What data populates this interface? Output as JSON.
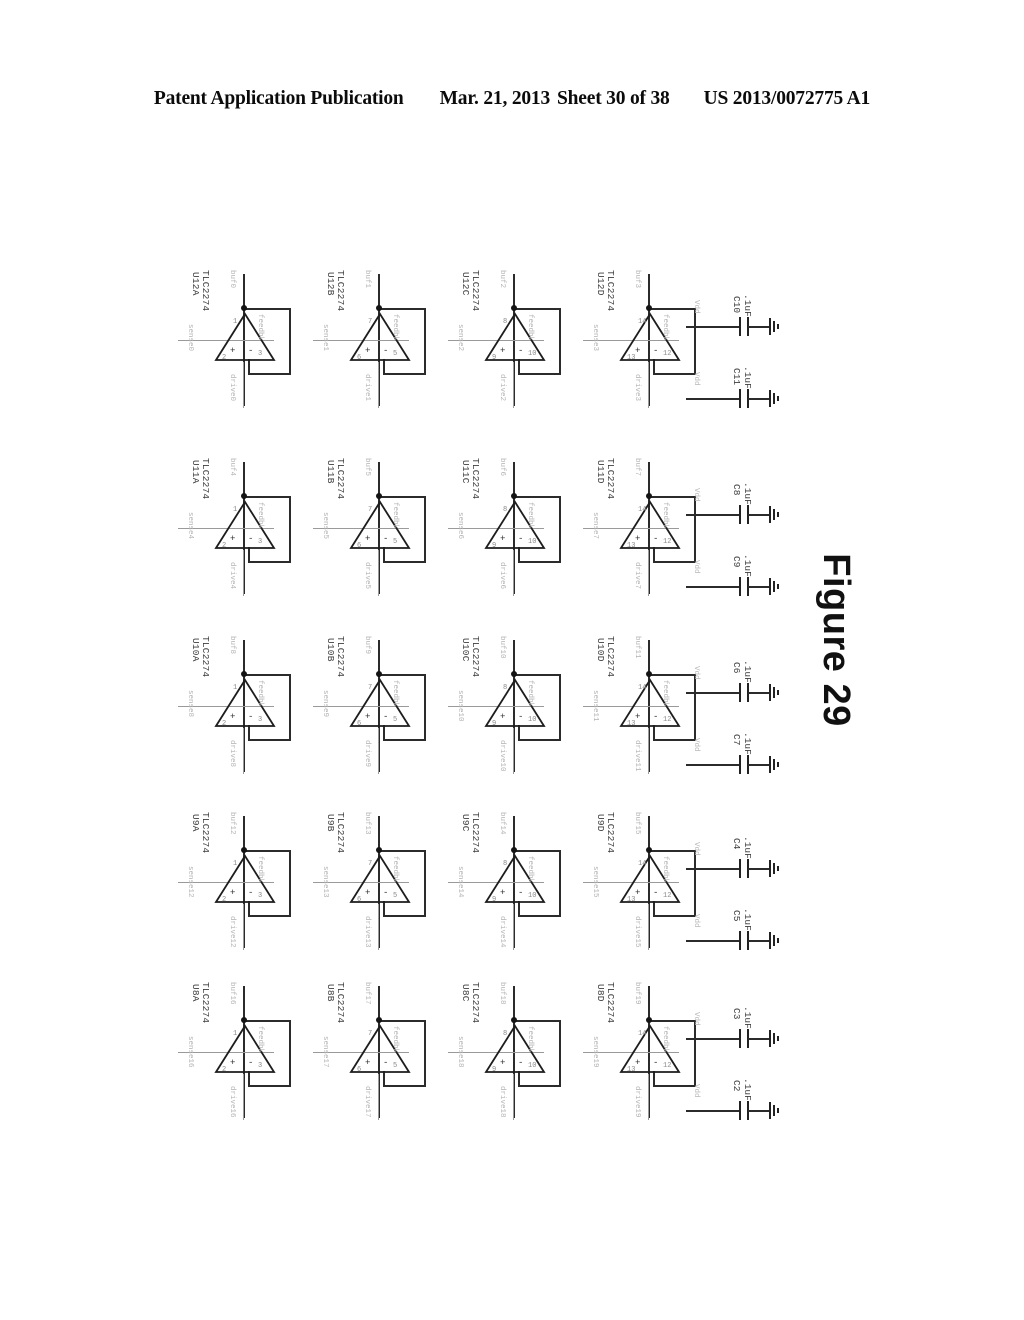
{
  "header": {
    "publication": "Patent Application Publication",
    "date": "Mar. 21, 2013",
    "sheet": "Sheet 30 of 38",
    "docnum": "US 2013/0072775 A1"
  },
  "figure": {
    "caption": "Figure 29"
  },
  "schematic": {
    "part_number": "TLC2274",
    "pin_labels": {
      "plus": "+",
      "minus": "-"
    },
    "opamps": [
      {
        "refdes": "U12A",
        "part": "TLC2274",
        "in_net": "sense0",
        "out_net": "buf0",
        "fb_net": "feedbk",
        "sup_net": "drive0",
        "pin_out": "1",
        "pin_minus": "2",
        "pin_plus": "3"
      },
      {
        "refdes": "U12B",
        "part": "TLC2274",
        "in_net": "sense1",
        "out_net": "buf1",
        "fb_net": "feedbk",
        "sup_net": "drive1",
        "pin_out": "7",
        "pin_minus": "6",
        "pin_plus": "5"
      },
      {
        "refdes": "U12C",
        "part": "TLC2274",
        "in_net": "sense2",
        "out_net": "buf2",
        "fb_net": "feedbk",
        "sup_net": "drive2",
        "pin_out": "8",
        "pin_minus": "9",
        "pin_plus": "10"
      },
      {
        "refdes": "U12D",
        "part": "TLC2274",
        "in_net": "sense3",
        "out_net": "buf3",
        "fb_net": "feedbk",
        "sup_net": "drive3",
        "pin_out": "14",
        "pin_minus": "13",
        "pin_plus": "12"
      },
      {
        "refdes": "U11A",
        "part": "TLC2274",
        "in_net": "sense4",
        "out_net": "buf4",
        "fb_net": "feedbk",
        "sup_net": "drive4",
        "pin_out": "1",
        "pin_minus": "2",
        "pin_plus": "3"
      },
      {
        "refdes": "U11B",
        "part": "TLC2274",
        "in_net": "sense5",
        "out_net": "buf5",
        "fb_net": "feedbk",
        "sup_net": "drive5",
        "pin_out": "7",
        "pin_minus": "6",
        "pin_plus": "5"
      },
      {
        "refdes": "U11C",
        "part": "TLC2274",
        "in_net": "sense6",
        "out_net": "buf6",
        "fb_net": "feedbk",
        "sup_net": "drive6",
        "pin_out": "8",
        "pin_minus": "9",
        "pin_plus": "10"
      },
      {
        "refdes": "U11D",
        "part": "TLC2274",
        "in_net": "sense7",
        "out_net": "buf7",
        "fb_net": "feedbk",
        "sup_net": "drive7",
        "pin_out": "14",
        "pin_minus": "13",
        "pin_plus": "12"
      },
      {
        "refdes": "U10A",
        "part": "TLC2274",
        "in_net": "sense8",
        "out_net": "buf8",
        "fb_net": "feedbk",
        "sup_net": "drive8",
        "pin_out": "1",
        "pin_minus": "2",
        "pin_plus": "3"
      },
      {
        "refdes": "U10B",
        "part": "TLC2274",
        "in_net": "sense9",
        "out_net": "buf9",
        "fb_net": "feedbk",
        "sup_net": "drive9",
        "pin_out": "7",
        "pin_minus": "6",
        "pin_plus": "5"
      },
      {
        "refdes": "U10C",
        "part": "TLC2274",
        "in_net": "sense10",
        "out_net": "buf10",
        "fb_net": "feedbk",
        "sup_net": "drive10",
        "pin_out": "8",
        "pin_minus": "9",
        "pin_plus": "10"
      },
      {
        "refdes": "U10D",
        "part": "TLC2274",
        "in_net": "sense11",
        "out_net": "buf11",
        "fb_net": "feedbk",
        "sup_net": "drive11",
        "pin_out": "14",
        "pin_minus": "13",
        "pin_plus": "12"
      },
      {
        "refdes": "U9A",
        "part": "TLC2274",
        "in_net": "sense12",
        "out_net": "buf12",
        "fb_net": "feedbk",
        "sup_net": "drive12",
        "pin_out": "1",
        "pin_minus": "2",
        "pin_plus": "3"
      },
      {
        "refdes": "U9B",
        "part": "TLC2274",
        "in_net": "sense13",
        "out_net": "buf13",
        "fb_net": "feedbk",
        "sup_net": "drive13",
        "pin_out": "7",
        "pin_minus": "6",
        "pin_plus": "5"
      },
      {
        "refdes": "U9C",
        "part": "TLC2274",
        "in_net": "sense14",
        "out_net": "buf14",
        "fb_net": "feedbk",
        "sup_net": "drive14",
        "pin_out": "8",
        "pin_minus": "9",
        "pin_plus": "10"
      },
      {
        "refdes": "U9D",
        "part": "TLC2274",
        "in_net": "sense15",
        "out_net": "buf15",
        "fb_net": "feedbk",
        "sup_net": "drive15",
        "pin_out": "14",
        "pin_minus": "13",
        "pin_plus": "12"
      },
      {
        "refdes": "U8A",
        "part": "TLC2274",
        "in_net": "sense16",
        "out_net": "buf16",
        "fb_net": "feedbk",
        "sup_net": "drive16",
        "pin_out": "1",
        "pin_minus": "2",
        "pin_plus": "3"
      },
      {
        "refdes": "U8B",
        "part": "TLC2274",
        "in_net": "sense17",
        "out_net": "buf17",
        "fb_net": "feedbk",
        "sup_net": "drive17",
        "pin_out": "7",
        "pin_minus": "6",
        "pin_plus": "5"
      },
      {
        "refdes": "U8C",
        "part": "TLC2274",
        "in_net": "sense18",
        "out_net": "buf18",
        "fb_net": "feedbk",
        "sup_net": "drive18",
        "pin_out": "8",
        "pin_minus": "9",
        "pin_plus": "10"
      },
      {
        "refdes": "U8D",
        "part": "TLC2274",
        "in_net": "sense19",
        "out_net": "buf19",
        "fb_net": "feedbk",
        "sup_net": "drive19",
        "pin_out": "14",
        "pin_minus": "13",
        "pin_plus": "12"
      }
    ],
    "capacitors": [
      {
        "refdes": "C10",
        "value": ".1uF",
        "net": "Vdd"
      },
      {
        "refdes": "C11",
        "value": ".1uF",
        "net": "Vdd"
      },
      {
        "refdes": "C8",
        "value": ".1uF",
        "net": "Vdd"
      },
      {
        "refdes": "C9",
        "value": ".1uF",
        "net": "Vdd"
      },
      {
        "refdes": "C6",
        "value": ".1uF",
        "net": "Vdd"
      },
      {
        "refdes": "C7",
        "value": ".1uF",
        "net": "Vdd"
      },
      {
        "refdes": "C4",
        "value": ".1uF",
        "net": "Vdd"
      },
      {
        "refdes": "C5",
        "value": ".1uF",
        "net": "Vdd"
      },
      {
        "refdes": "C3",
        "value": ".1uF",
        "net": "Vdd"
      },
      {
        "refdes": "C2",
        "value": ".1uF",
        "net": "Vdd"
      }
    ]
  }
}
